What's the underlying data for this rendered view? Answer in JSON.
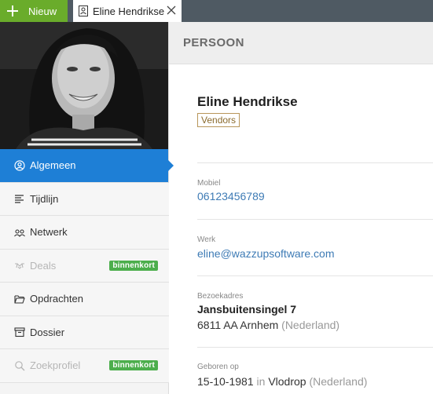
{
  "topbar": {
    "new_button_label": "Nieuw",
    "tab_label": "Eline Hendrikse"
  },
  "sidebar": {
    "items": [
      {
        "label": "Algemeen",
        "icon": "user-circle-icon",
        "active": true
      },
      {
        "label": "Tijdlijn",
        "icon": "timeline-lines-icon"
      },
      {
        "label": "Netwerk",
        "icon": "network-people-icon"
      },
      {
        "label": "Deals",
        "icon": "handshake-icon",
        "disabled": true,
        "badge": "binnenkort"
      },
      {
        "label": "Opdrachten",
        "icon": "folder-open-icon"
      },
      {
        "label": "Dossier",
        "icon": "archive-box-icon"
      },
      {
        "label": "Zoekprofiel",
        "icon": "search-icon",
        "disabled": true,
        "badge": "binnenkort"
      }
    ]
  },
  "header": {
    "title": "PERSOON"
  },
  "person": {
    "name": "Eline Hendrikse",
    "tag": "Vendors",
    "mobile_label": "Mobiel",
    "mobile": "06123456789",
    "work_label": "Werk",
    "work_email": "eline@wazzupsoftware.com",
    "address_label": "Bezoekadres",
    "street": "Jansbuitensingel 7",
    "postal_city": "6811 AA Arnhem",
    "country": "(Nederland)",
    "birth_label": "Geboren op",
    "birth_date": "15-10-1981",
    "birth_in": "in",
    "birth_place": "Vlodrop",
    "birth_country": "(Nederland)"
  },
  "colors": {
    "accent_blue": "#1e7fd6",
    "new_green": "#6aac2b",
    "badge_green": "#4cae4c",
    "topbar": "#4f5a63",
    "link": "#3e7bb5",
    "tag_border": "#b8965a"
  }
}
